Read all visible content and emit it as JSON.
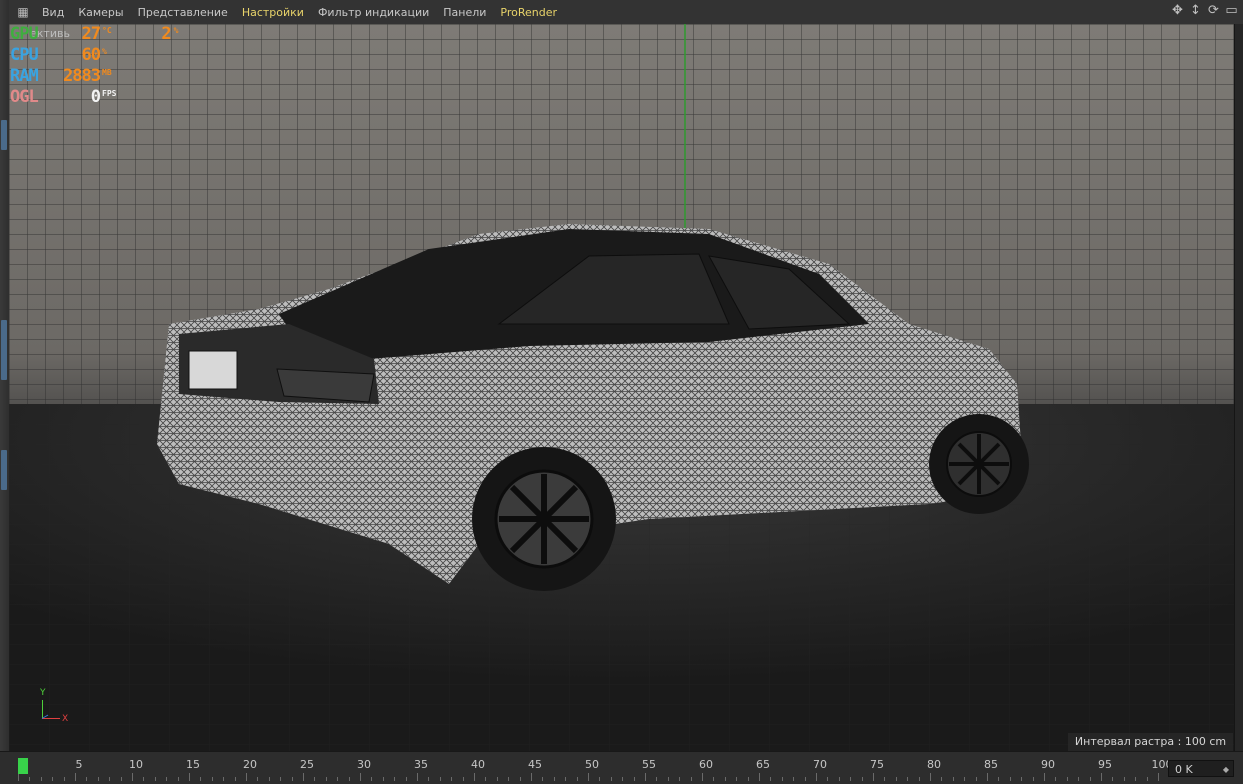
{
  "menubar": {
    "items": [
      {
        "label": "Вид",
        "highlight": false
      },
      {
        "label": "Камеры",
        "highlight": false
      },
      {
        "label": "Представление",
        "highlight": false
      },
      {
        "label": "Настройки",
        "highlight": true
      },
      {
        "label": "Фильтр индикации",
        "highlight": false
      },
      {
        "label": "Панели",
        "highlight": false
      },
      {
        "label": "ProRender",
        "highlight": true
      }
    ],
    "nav_icons": [
      "move-view-icon",
      "dolly-view-icon",
      "rotate-view-icon",
      "toggle-layout-icon"
    ]
  },
  "viewport": {
    "camera_label": "ективь",
    "grid_interval": "Интервал растра : 100 cm",
    "axis": {
      "y": "Y",
      "x": "X"
    }
  },
  "hud": {
    "gpu": {
      "label": "GPU",
      "value": "27",
      "unit": "°C",
      "value2": "2",
      "unit2": "%",
      "color": "#3fae3f"
    },
    "cpu": {
      "label": "CPU",
      "value": "60",
      "unit": "%",
      "color": "#3aa3e0"
    },
    "ram": {
      "label": "RAM",
      "value": "2883",
      "unit": "MB",
      "color": "#3aa3e0"
    },
    "ogl": {
      "label": "OGL",
      "value": "0",
      "unit": "FPS",
      "color": "#e08a8a"
    }
  },
  "timeline": {
    "labels": [
      "0",
      "5",
      "10",
      "15",
      "20",
      "25",
      "30",
      "35",
      "40",
      "45",
      "50",
      "55",
      "60",
      "65",
      "70",
      "75",
      "80",
      "85",
      "90",
      "95",
      "100"
    ],
    "current_frame": "0 K"
  },
  "colors": {
    "accent": "#e8d36a",
    "value": "#f08a1e",
    "playhead": "#38d24a"
  }
}
